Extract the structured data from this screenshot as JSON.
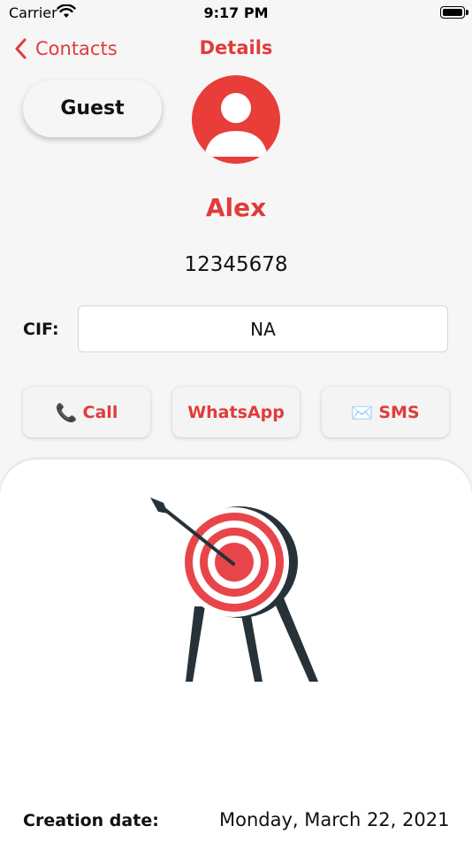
{
  "status_bar": {
    "carrier": "Carrier",
    "time": "9:17 PM"
  },
  "nav": {
    "back_label": "Contacts",
    "title": "Details"
  },
  "guest_button": {
    "label": "Guest"
  },
  "contact": {
    "name": "Alex",
    "phone": "12345678"
  },
  "cif": {
    "label": "CIF:",
    "value": "NA"
  },
  "actions": {
    "call": {
      "icon": "📞",
      "label": "Call"
    },
    "whatsapp": {
      "label": "WhatsApp"
    },
    "sms": {
      "icon": "✉️",
      "label": "SMS"
    }
  },
  "details": {
    "creation_label": "Creation date:",
    "creation_value": "Monday, March 22, 2021"
  },
  "colors": {
    "accent": "#e03c3a",
    "avatar_bg": "#e83d39",
    "background": "#f7f6f7",
    "card": "#ffffff",
    "target_dark": "#263238"
  },
  "icons": {
    "wifi": "wifi-icon",
    "battery": "battery-icon",
    "back": "chevron-left-icon",
    "avatar": "person-icon",
    "illustration": "target-arrow-icon"
  }
}
